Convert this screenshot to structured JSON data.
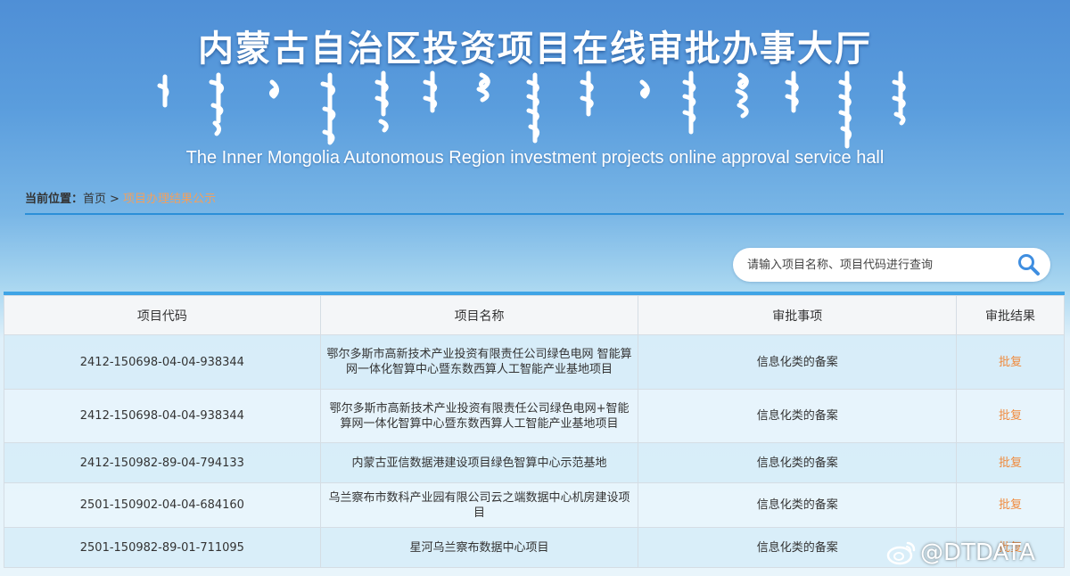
{
  "banner": {
    "title": "内蒙古自治区投资项目在线审批办事大厅",
    "subtitle": "The Inner Mongolia Autonomous Region investment projects online approval service hall"
  },
  "breadcrumb": {
    "label": "当前位置：",
    "home": "首页",
    "separator": ">",
    "current": "项目办理结果公示"
  },
  "search": {
    "placeholder": "请输入项目名称、项目代码进行查询",
    "icon": "search-icon"
  },
  "table": {
    "headers": [
      "项目代码",
      "项目名称",
      "审批事项",
      "审批结果"
    ],
    "rows": [
      {
        "code": "2412-150698-04-04-938344",
        "name": "鄂尔多斯市高新技术产业投资有限责任公司绿色电网 智能算网一体化智算中心暨东数西算人工智能产业基地项目",
        "item": "信息化类的备案",
        "result": "批复"
      },
      {
        "code": "2412-150698-04-04-938344",
        "name": "鄂尔多斯市高新技术产业投资有限责任公司绿色电网+智能算网一体化智算中心暨东数西算人工智能产业基地项目",
        "item": "信息化类的备案",
        "result": "批复"
      },
      {
        "code": "2412-150982-89-04-794133",
        "name": "内蒙古亚信数据港建设项目绿色智算中心示范基地",
        "item": "信息化类的备案",
        "result": "批复"
      },
      {
        "code": "2501-150902-04-04-684160",
        "name": "乌兰察布市数科产业园有限公司云之端数据中心机房建设项目",
        "item": "信息化类的备案",
        "result": "批复"
      },
      {
        "code": "2501-150982-89-01-711095",
        "name": "星河乌兰察布数据中心项目",
        "item": "信息化类的备案",
        "result": "批复"
      }
    ]
  },
  "watermark": {
    "text": "@DTDATA",
    "icon": "weibo-icon"
  },
  "colors": {
    "accent_line": "#3fa4e6",
    "result_link": "#f08a3c",
    "breadcrumb_current": "#f0a060"
  }
}
